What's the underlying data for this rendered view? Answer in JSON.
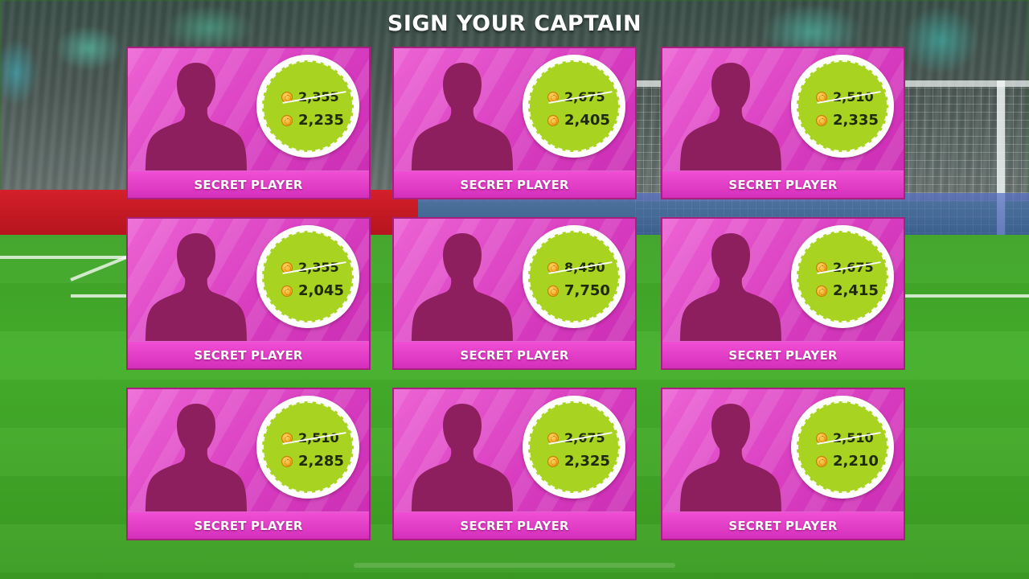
{
  "screen": {
    "title": "SIGN YOUR CAPTAIN"
  },
  "colors": {
    "card_pink": "#d83cc0",
    "badge_green": "#a8d321",
    "footer_pink": "#f14fd5",
    "silhouette": "#8e1f5e"
  },
  "icons": {
    "player": "player-silhouette-icon",
    "currency": "coin-icon"
  },
  "cards": [
    {
      "label": "SECRET PLAYER",
      "old_price": "2,355",
      "new_price": "2,235"
    },
    {
      "label": "SECRET PLAYER",
      "old_price": "2,675",
      "new_price": "2,405"
    },
    {
      "label": "SECRET PLAYER",
      "old_price": "2,510",
      "new_price": "2,335"
    },
    {
      "label": "SECRET PLAYER",
      "old_price": "2,355",
      "new_price": "2,045"
    },
    {
      "label": "SECRET PLAYER",
      "old_price": "8,490",
      "new_price": "7,750"
    },
    {
      "label": "SECRET PLAYER",
      "old_price": "2,675",
      "new_price": "2,415"
    },
    {
      "label": "SECRET PLAYER",
      "old_price": "2,510",
      "new_price": "2,285"
    },
    {
      "label": "SECRET PLAYER",
      "old_price": "2,675",
      "new_price": "2,325"
    },
    {
      "label": "SECRET PLAYER",
      "old_price": "2,510",
      "new_price": "2,210"
    }
  ]
}
